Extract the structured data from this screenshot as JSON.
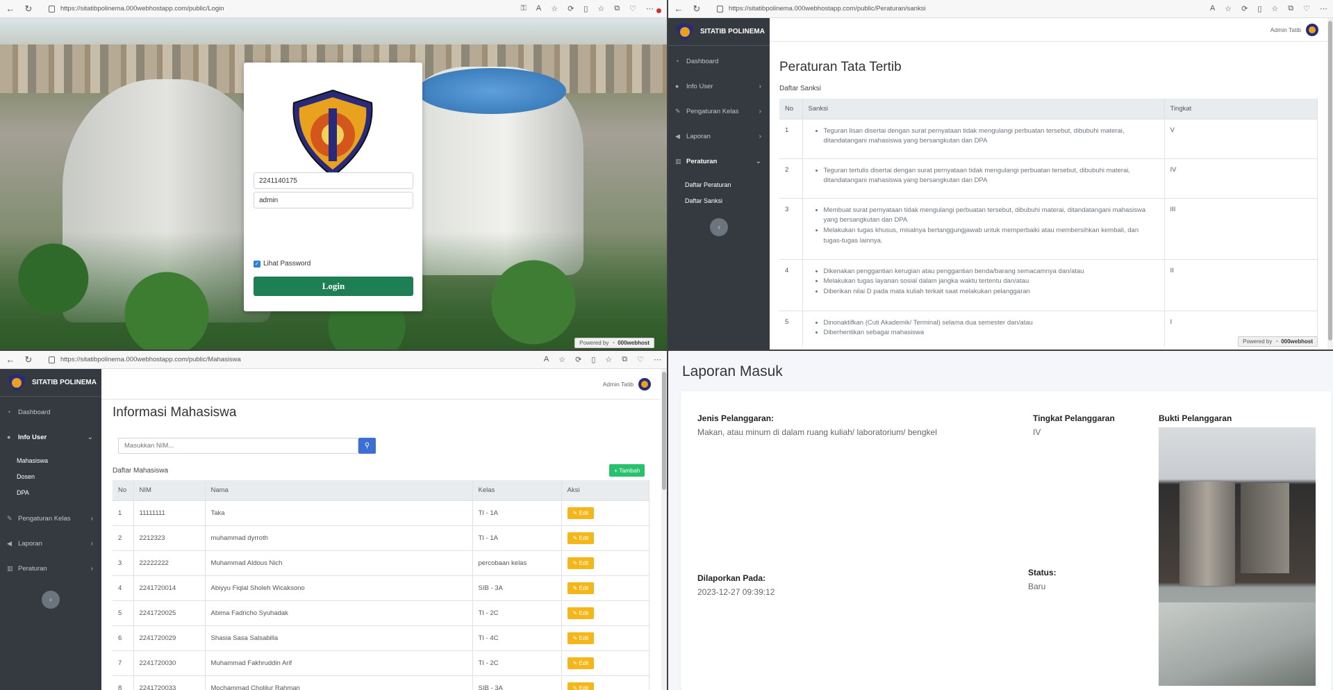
{
  "login_window": {
    "url": "https://sitatibpolinema.000webhostapp.com/public/Login",
    "username_value": "2241140175",
    "password_value": "admin",
    "show_password_label": "Lihat Password",
    "login_button": "Login",
    "powered_label": "Powered by",
    "powered_brand": "000webhost",
    "notification_count": "1"
  },
  "peraturan_window": {
    "url": "https://sitatibpolinema.000webhostapp.com/public/Peraturan/sanksi",
    "brand": "SITATIB POLINEMA",
    "admin_name": "Admin Tatib",
    "menu": [
      "Dashboard",
      "Info User",
      "Pengaturan Kelas",
      "Laporan",
      "Peraturan"
    ],
    "submenu": [
      "Daftar Peraturan",
      "Daftar Sanksi"
    ],
    "page_title": "Peraturan Tata Tertib",
    "section_title": "Daftar Sanksi",
    "table_headers": [
      "No",
      "Sanksi",
      "Tingkat"
    ],
    "rows": [
      {
        "no": "1",
        "items": [
          "Teguran lisan disertai dengan surat pernyataan tidak mengulangi perbuatan tersebut, dibubuhi materai, ditandatangani mahasiswa yang bersangkutan dan DPA"
        ],
        "tingkat": "V"
      },
      {
        "no": "2",
        "items": [
          "Teguran tertulis disertai dengan surat pernyataan tidak mengulangi perbuatan tersebut, dibubuhi materai, ditandatangani mahasiswa yang bersangkutan dan DPA"
        ],
        "tingkat": "IV"
      },
      {
        "no": "3",
        "items": [
          "Membuat surat pernyataan tidak mengulangi perbuatan tersebut, dibubuhi materai, ditandatangani mahasiswa yang bersangkutan dan DPA",
          "Melakukan tugas khusus, misalnya bertanggungjawab untuk memperbaiki atau membersihkan kembali, dan tugas-tugas lainnya."
        ],
        "tingkat": "III"
      },
      {
        "no": "4",
        "items": [
          "Dikenakan penggantian kerugian atau penggantian benda/barang semacamnya dan/atau",
          "Melakukan tugas layanan sosial dalam jangka waktu tertentu dan/atau",
          "Diberikan nilai D pada mata kuliah terkait saat melakukan pelanggaran"
        ],
        "tingkat": "II"
      },
      {
        "no": "5",
        "items": [
          "Dinonaktifkan (Cuti Akademik/ Terminal) selama dua semester dan/atau",
          "Diberhentikan sebagai mahasiswa"
        ],
        "tingkat": "I"
      }
    ],
    "powered_label": "Powered by",
    "powered_brand": "000webhost"
  },
  "mahasiswa_window": {
    "url": "https://sitatibpolinema.000webhostapp.com/public/Mahasiswa",
    "brand": "SITATIB POLINEMA",
    "admin_name": "Admin Tatib",
    "menu": [
      "Dashboard",
      "Info User",
      "Pengaturan Kelas",
      "Laporan",
      "Peraturan"
    ],
    "submenu": [
      "Mahasiswa",
      "Dosen",
      "DPA"
    ],
    "page_title": "Informasi Mahasiswa",
    "search_placeholder": "Masukkan NIM...",
    "section_title": "Daftar Mahasiswa",
    "add_button": "Tambah",
    "table_headers": [
      "No",
      "NIM",
      "Nama",
      "Kelas",
      "Aksi"
    ],
    "edit_label": "Edit",
    "rows": [
      [
        "1",
        "11111111",
        "Taka",
        "TI - 1A"
      ],
      [
        "2",
        "2212323",
        "muhammad dyrroth",
        "TI - 1A"
      ],
      [
        "3",
        "22222222",
        "Muhammad Aldous Nich",
        "percobaan kelas"
      ],
      [
        "4",
        "2241720014",
        "Abiyyu Fiqlal Sholeh Wicaksono",
        "SIB - 3A"
      ],
      [
        "5",
        "2241720025",
        "Abima Fadricho Syuhadak",
        "TI - 2C"
      ],
      [
        "6",
        "2241720029",
        "Shasia Sasa Salsabilla",
        "TI - 4C"
      ],
      [
        "7",
        "2241720030",
        "Muhammad Fakhruddin Arif",
        "TI - 2C"
      ],
      [
        "8",
        "2241720033",
        "Mochammad Cholilur Rahman",
        "SIB - 3A"
      ]
    ]
  },
  "laporan_window": {
    "page_title": "Laporan Masuk",
    "jenis_label": "Jenis Pelanggaran:",
    "jenis_value": "Makan, atau minum di dalam ruang kuliah/ laboratorium/ bengkel",
    "tingkat_label": "Tingkat Pelanggaran",
    "tingkat_value": "IV",
    "bukti_label": "Bukti Pelanggaran",
    "dilaporkan_label": "Dilaporkan Pada:",
    "dilaporkan_value": "2023-12-27 09:39:12",
    "status_label": "Status:",
    "status_value": "Baru"
  }
}
